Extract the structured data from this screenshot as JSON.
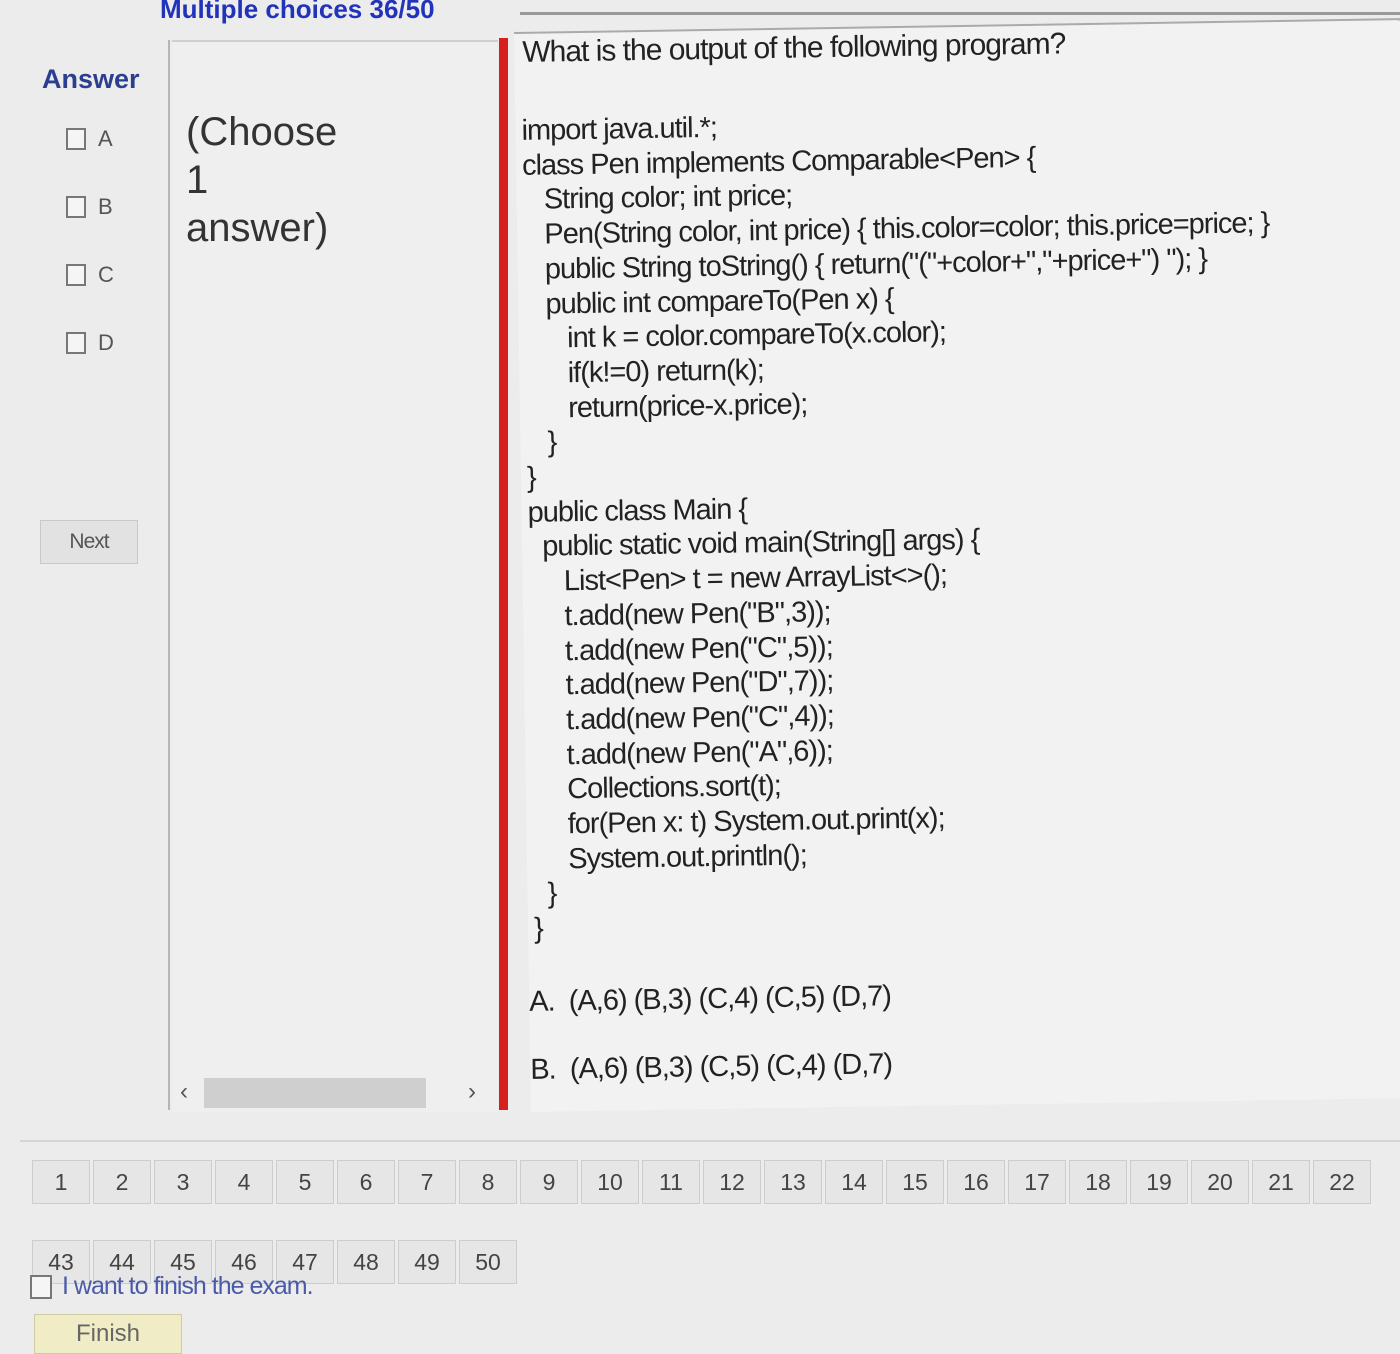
{
  "header": {
    "title": "Multiple choices 36/50"
  },
  "answer_panel": {
    "heading": "Answer",
    "options": [
      "A",
      "B",
      "C",
      "D"
    ],
    "next_label": "Next",
    "instruction": "(Choose\n1\nanswer)"
  },
  "question": {
    "prompt": "What is the output of the following program?",
    "code": [
      "import java.util.*;",
      "class Pen implements Comparable<Pen> {",
      "   String color; int price;",
      "   Pen(String color, int price) { this.color=color; this.price=price; }",
      "   public String toString() { return(\"(\"+color+\",\"+price+\") \"); }",
      "   public int compareTo(Pen x) {",
      "      int k = color.compareTo(x.color);",
      "      if(k!=0) return(k);",
      "      return(price-x.price);",
      "   }",
      "}",
      "public class Main {",
      "  public static void main(String[] args) {",
      "     List<Pen> t = new ArrayList<>();",
      "     t.add(new Pen(\"B\",3));",
      "     t.add(new Pen(\"C\",5));",
      "     t.add(new Pen(\"D\",7));",
      "     t.add(new Pen(\"C\",4));",
      "     t.add(new Pen(\"A\",6));",
      "     Collections.sort(t);",
      "     for(Pen x: t) System.out.print(x);",
      "     System.out.println();",
      "  }",
      "}"
    ],
    "choices": [
      "A.  (A,6) (B,3) (C,4) (C,5) (D,7)",
      "B.  (A,6) (B,3) (C,5) (C,4) (D,7)"
    ]
  },
  "navigation": {
    "row1": [
      "1",
      "2",
      "3",
      "4",
      "5",
      "6",
      "7",
      "8",
      "9",
      "10",
      "11",
      "12",
      "13",
      "14",
      "15",
      "16",
      "17",
      "18",
      "19",
      "20",
      "21",
      "22"
    ],
    "row2": [
      "43",
      "44",
      "45",
      "46",
      "47",
      "48",
      "49",
      "50"
    ]
  },
  "finish": {
    "checkbox_label": "I want to finish the exam.",
    "button_label": "Finish"
  },
  "colors": {
    "title": "#2233bb",
    "answer_heading": "#2a3f8f",
    "accent_bar": "#d71f1f",
    "finish_button": "#f0edc6"
  }
}
